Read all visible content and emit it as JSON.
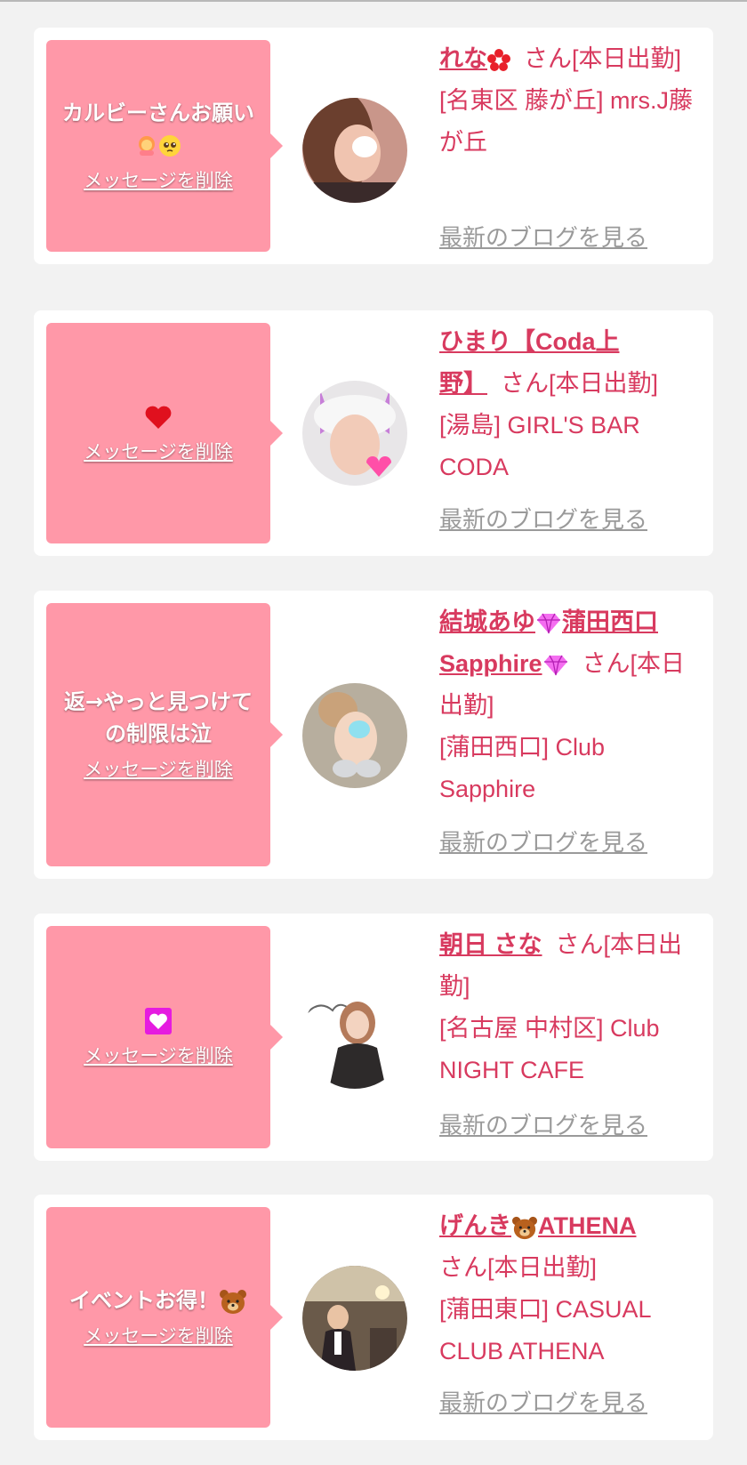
{
  "delete_label": "メッセージを削除",
  "blog_label": "最新のブログを見る",
  "colors": {
    "page_bg": "#f2f2f2",
    "card_bg": "#ffffff",
    "bubble": "#ff98a8",
    "name_text": "#d83a5f",
    "blog_link": "#9a9a9a"
  },
  "cards": [
    {
      "message": "カルビーさんお願い",
      "message_icons": [
        "woman-emoji-icon",
        "pleading-face-icon"
      ],
      "name": "れな",
      "name_icon": "red-flower-icon",
      "suffix": "さん[本日出勤]",
      "area": "[名東区 藤が丘] mrs.J藤が丘"
    },
    {
      "message": "",
      "message_icons": [
        "red-heart-icon"
      ],
      "name": "ひまり【Coda上野】",
      "name_icon": "",
      "suffix": "さん[本日出勤]",
      "area": "[湯島] GIRL'S BAR CODA"
    },
    {
      "message": "返→やっと見つけての制限は泣",
      "message_icons": [],
      "name": "結城あゆ",
      "name_icon": "gem-icon",
      "name_mid": "蒲田西口Sapphire",
      "name_icon2": "gem-icon",
      "suffix": "さん[本日出勤]",
      "area": "[蒲田西口] Club Sapphire"
    },
    {
      "message": "",
      "message_icons": [
        "heart-box-icon"
      ],
      "name": "朝日 さな",
      "name_icon": "",
      "suffix": "さん[本日出勤]",
      "area": "[名古屋 中村区] Club NIGHT CAFE"
    },
    {
      "message": "イベントお得！",
      "message_icons": [
        "bear-face-icon"
      ],
      "name": "げんき",
      "name_icon": "bear-face-icon",
      "name_mid": "ATHENA",
      "suffix": "さん[本日出勤]",
      "area": "[蒲田東口] CASUAL CLUB ATHENA"
    }
  ]
}
